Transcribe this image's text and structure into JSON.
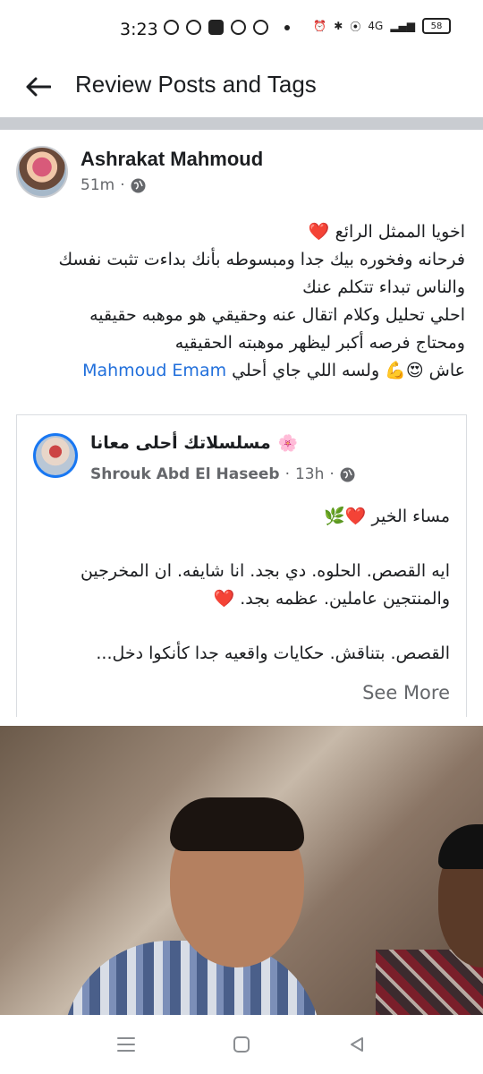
{
  "status_bar": {
    "time": "3:23",
    "network": "4G",
    "battery": "58"
  },
  "app_bar": {
    "title": "Review Posts and Tags",
    "back_icon": "arrow-left-icon"
  },
  "post": {
    "author": "Ashrakat Mahmoud",
    "time": "51m",
    "privacy_icon": "globe-icon",
    "text_lines": [
      "اخويا الممثل الرائع ❤️",
      "فرحانه وفخوره بيك جدا ومبسوطه بأنك بداءت تثبت نفسك",
      "والناس تبداء تتكلم عنك",
      "احلي تحليل وكلام اتقال عنه وحقيقي هو موهبه حقيقيه",
      "ومحتاج فرصه أكبر ليظهر موهبته الحقيقيه"
    ],
    "last_line_prefix": "عاش 😍💪 ولسه اللي جاي أحلي",
    "mention": "Mahmoud Emam"
  },
  "shared_post": {
    "group_name": "مسلسلاتك أحلى معانا",
    "group_emoji": "🌸",
    "author": "Shrouk Abd El Haseeb",
    "time": "13h",
    "greeting": "مساء الخير ❤️🌿",
    "paragraph1_line1": "ايه القصص. الحلوه. دي  بجد. انا شايفه.  ان المخرجين",
    "paragraph1_line2": "والمنتجين عاملين. عظمه بجد. ❤️",
    "paragraph2_line1": "القصص. بتناقش.  حكايات واقعيه جدا  كأنكوا دخل...",
    "see_more": "See More"
  },
  "photo": {
    "description_icon": "photo-image"
  },
  "nav_bar": {
    "menu_icon": "recents-icon",
    "home_icon": "home-icon",
    "back_icon": "back-triangle-icon"
  }
}
